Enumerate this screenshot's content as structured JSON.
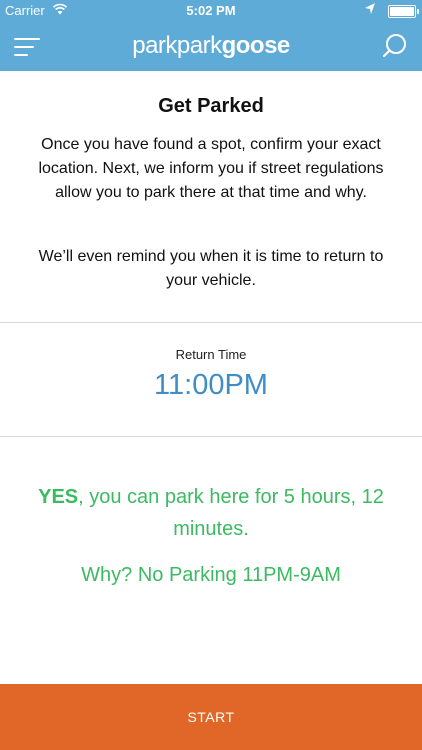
{
  "status_bar": {
    "carrier": "Carrier",
    "time": "5:02 PM",
    "wifi_icon": "wifi-icon",
    "location_icon": "location-arrow-icon",
    "battery_icon": "battery-icon"
  },
  "nav": {
    "logo_light": "parkpark",
    "logo_bold": "goose",
    "menu_icon": "hamburger-menu-icon",
    "search_icon": "search-icon"
  },
  "intro": {
    "title": "Get Parked",
    "paragraph1": "Once you have found a spot, confirm your exact location. Next, we inform you if street regulations allow you to park there at that time and why.",
    "paragraph2": "We’ll even remind you when it is time to return to your vehicle."
  },
  "return_time": {
    "label": "Return Time",
    "value": "11:00PM"
  },
  "result": {
    "yes": "YES",
    "message": ", you can park here for 5 hours, 12 minutes.",
    "why": "Why? No Parking 11PM-9AM"
  },
  "start_button": {
    "label": "START"
  },
  "colors": {
    "header": "#5fabd8",
    "accent_blue": "#3f8dc6",
    "success_green": "#3cba62",
    "start_orange": "#e06727"
  }
}
